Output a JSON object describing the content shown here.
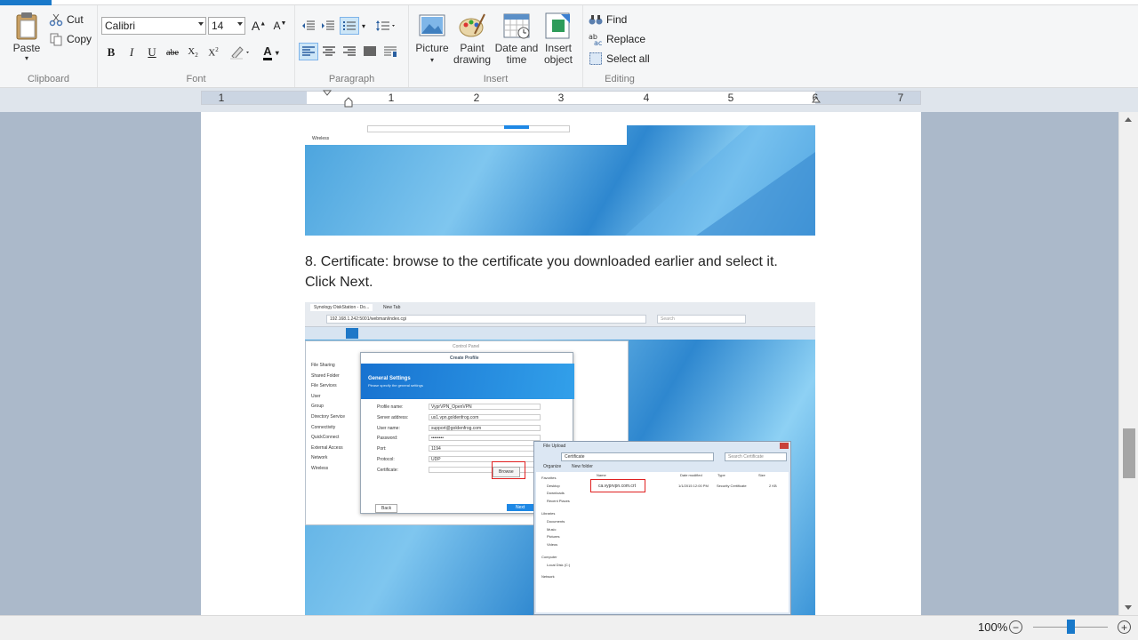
{
  "ribbon": {
    "clipboard": {
      "label": "Clipboard",
      "paste": "Paste",
      "cut": "Cut",
      "copy": "Copy"
    },
    "font": {
      "label": "Font",
      "family": "Calibri",
      "size": "14"
    },
    "paragraph": {
      "label": "Paragraph"
    },
    "insert": {
      "label": "Insert",
      "picture": "Picture",
      "paint_drawing_1": "Paint",
      "paint_drawing_2": "drawing",
      "datetime_1": "Date and",
      "datetime_2": "time",
      "object_1": "Insert",
      "object_2": "object"
    },
    "editing": {
      "label": "Editing",
      "find": "Find",
      "replace": "Replace",
      "select_all": "Select all"
    }
  },
  "ruler": {
    "numbers": [
      "1",
      "1",
      "2",
      "3",
      "4",
      "5",
      "6",
      "7"
    ]
  },
  "document": {
    "paragraph": "8. Certificate: browse to the certificate you downloaded earlier and select it. Click Next.",
    "screenshot": {
      "tab1": "Synology DiskStation - Do...",
      "tab2": "New Tab",
      "url": "192.168.1.242:5001/webman/index.cgi",
      "search": "Search",
      "sidebar": [
        "File Sharing",
        "Shared Folder",
        "File Services",
        "User",
        "Group",
        "Directory Service",
        "Connectivity",
        "QuickConnect",
        "External Access",
        "Network",
        "Wireless"
      ],
      "dialog_title": "Create Profile",
      "dialog_heading": "General Settings",
      "dialog_sub": "Please specify the general settings",
      "fields": [
        {
          "label": "Profile name:",
          "value": "VyprVPN_OpenVPN"
        },
        {
          "label": "Server address:",
          "value": "us1.vpn.goldenfrog.com"
        },
        {
          "label": "User name:",
          "value": "support@goldenfrog.com"
        },
        {
          "label": "Password:",
          "value": "••••••••"
        },
        {
          "label": "Port:",
          "value": "1194"
        },
        {
          "label": "Protocol:",
          "value": "UDP"
        },
        {
          "label": "Certificate:",
          "value": ""
        }
      ],
      "browse": "Browse",
      "back": "Back",
      "next": "Next",
      "control_panel": "Control Panel",
      "upload_title": "File Upload",
      "upload_path": "Certificate",
      "upload_search": "Search Certificate",
      "organize": "Organize",
      "new_folder": "New folder",
      "cols": [
        "Name",
        "Date modified",
        "Type",
        "Size"
      ],
      "nav": [
        "Favorites",
        "Desktop",
        "Downloads",
        "Recent Places",
        "Libraries",
        "Documents",
        "Music",
        "Pictures",
        "Videos",
        "Computer",
        "Local Disk (C:)",
        "Network"
      ],
      "file": {
        "name": "ca.vyprvpn.com.crt",
        "date": "1/1/2015 12:00 PM",
        "type": "Security Certificate",
        "size": "2 KB"
      }
    }
  },
  "status": {
    "zoom": "100%"
  },
  "colors": {
    "accent": "#1979ca",
    "highlight": "#e02020"
  }
}
